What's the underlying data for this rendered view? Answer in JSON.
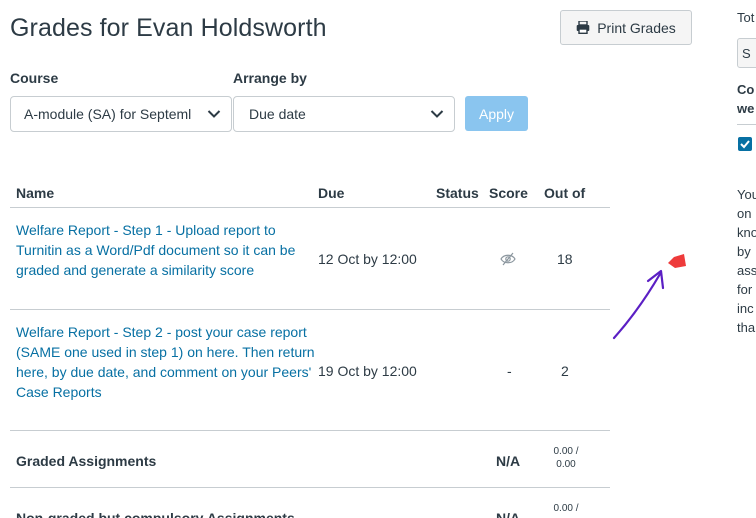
{
  "page": {
    "title": "Grades for Evan Holdsworth",
    "print_button": "Print Grades"
  },
  "filters": {
    "course_label": "Course",
    "course_value": "A-module (SA) for Septeml",
    "arrange_label": "Arrange by",
    "arrange_value": "Due date",
    "apply_label": "Apply"
  },
  "table": {
    "headers": {
      "name": "Name",
      "due": "Due",
      "status": "Status",
      "score": "Score",
      "out_of": "Out of"
    },
    "assignments": [
      {
        "name": "Welfare Report - Step 1 - Upload report to Turnitin as a Word/Pdf document so it can be graded and generate a similarity score",
        "due": "12 Oct by 12:00",
        "status": "",
        "score_icon": "eye-slash-icon",
        "out_of": "18"
      },
      {
        "name": "Welfare Report - Step 2 - post your case report (SAME one used in step 1) on here. Then return here, by due date, and comment on your Peers' Case Reports",
        "due": "19 Oct by 12:00",
        "status": "",
        "score": "-",
        "out_of": "2"
      }
    ],
    "groups": [
      {
        "name": "Graded Assignments",
        "score": "N/A",
        "out_of_top": "0.00 /",
        "out_of_bottom": "0.00"
      },
      {
        "name": "Non-graded but compulsory Assignments",
        "score": "N/A",
        "out_of_top": "0.00 /",
        "out_of_bottom": ""
      }
    ]
  },
  "sidebar": {
    "line1": "Tot",
    "box_text": "S",
    "heading1": "Co",
    "heading2": "we",
    "para": [
      "You",
      "on",
      "kno",
      "by",
      "ass",
      "for",
      "inc",
      "tha"
    ]
  },
  "annotation": {
    "color": "#5b1fc4",
    "marker_color": "#ee3b3b"
  }
}
